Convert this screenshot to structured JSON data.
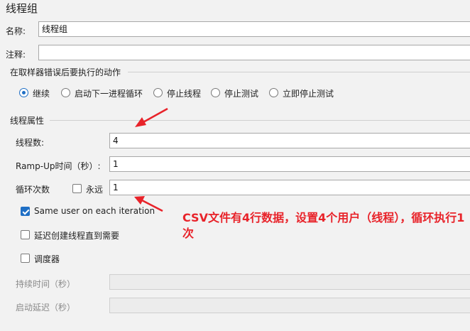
{
  "panel_title": "线程组",
  "name_label": "名称:",
  "name_value": "线程组",
  "comment_label": "注释:",
  "comment_value": "",
  "error_section": {
    "title": "在取样器错误后要执行的动作",
    "options": [
      "继续",
      "启动下一进程循环",
      "停止线程",
      "停止测试",
      "立即停止测试"
    ],
    "selected": "继续"
  },
  "thread_props": {
    "title": "线程属性",
    "threads_label": "线程数:",
    "threads_value": "4",
    "rampup_label": "Ramp-Up时间（秒）:",
    "rampup_value": "1",
    "loop_label": "循环次数",
    "forever_label": "永远",
    "forever_checked": false,
    "loop_value": "1",
    "same_user_label": "Same user on each iteration",
    "same_user_checked": true,
    "delay_label": "延迟创建线程直到需要",
    "delay_checked": false,
    "scheduler_label": "调度器",
    "scheduler_checked": false,
    "duration_label": "持续时间（秒）",
    "startup_delay_label": "启动延迟（秒）"
  },
  "annotation": {
    "text": "CSV文件有4行数据，设置4个用户（线程），循环执行1次",
    "color": "#e8232a"
  }
}
